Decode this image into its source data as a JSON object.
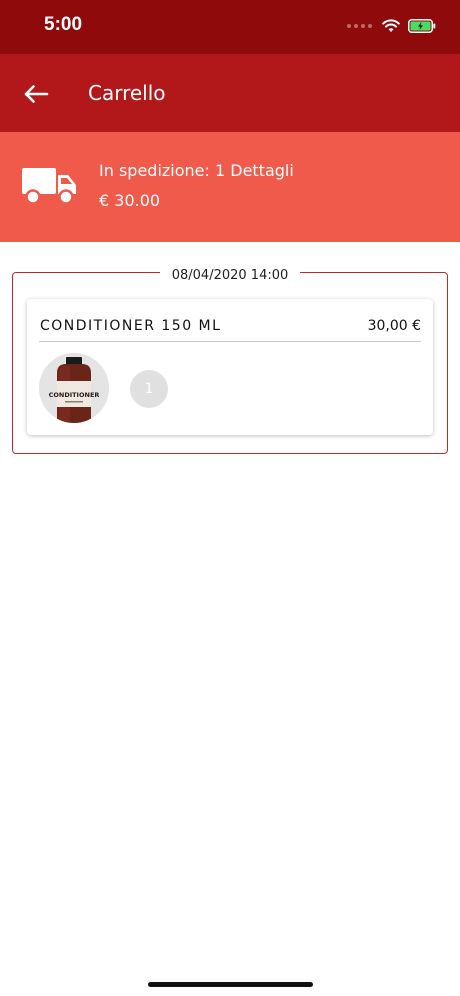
{
  "status_bar": {
    "time": "5:00"
  },
  "header": {
    "title": "Carrello"
  },
  "shipping": {
    "label": "In spedizione: 1 Dettagli",
    "total": "€ 30.00"
  },
  "order": {
    "date": "08/04/2020 14:00",
    "items": [
      {
        "name": "CONDITIONER 150 ML",
        "price": "30,00 €",
        "quantity": "1",
        "label_text": "CONDITIONER"
      }
    ]
  },
  "colors": {
    "status_bar": "#8f0a0a",
    "app_bar": "#b2181a",
    "banner": "#f05a4b",
    "accent_border": "#c3282a"
  }
}
